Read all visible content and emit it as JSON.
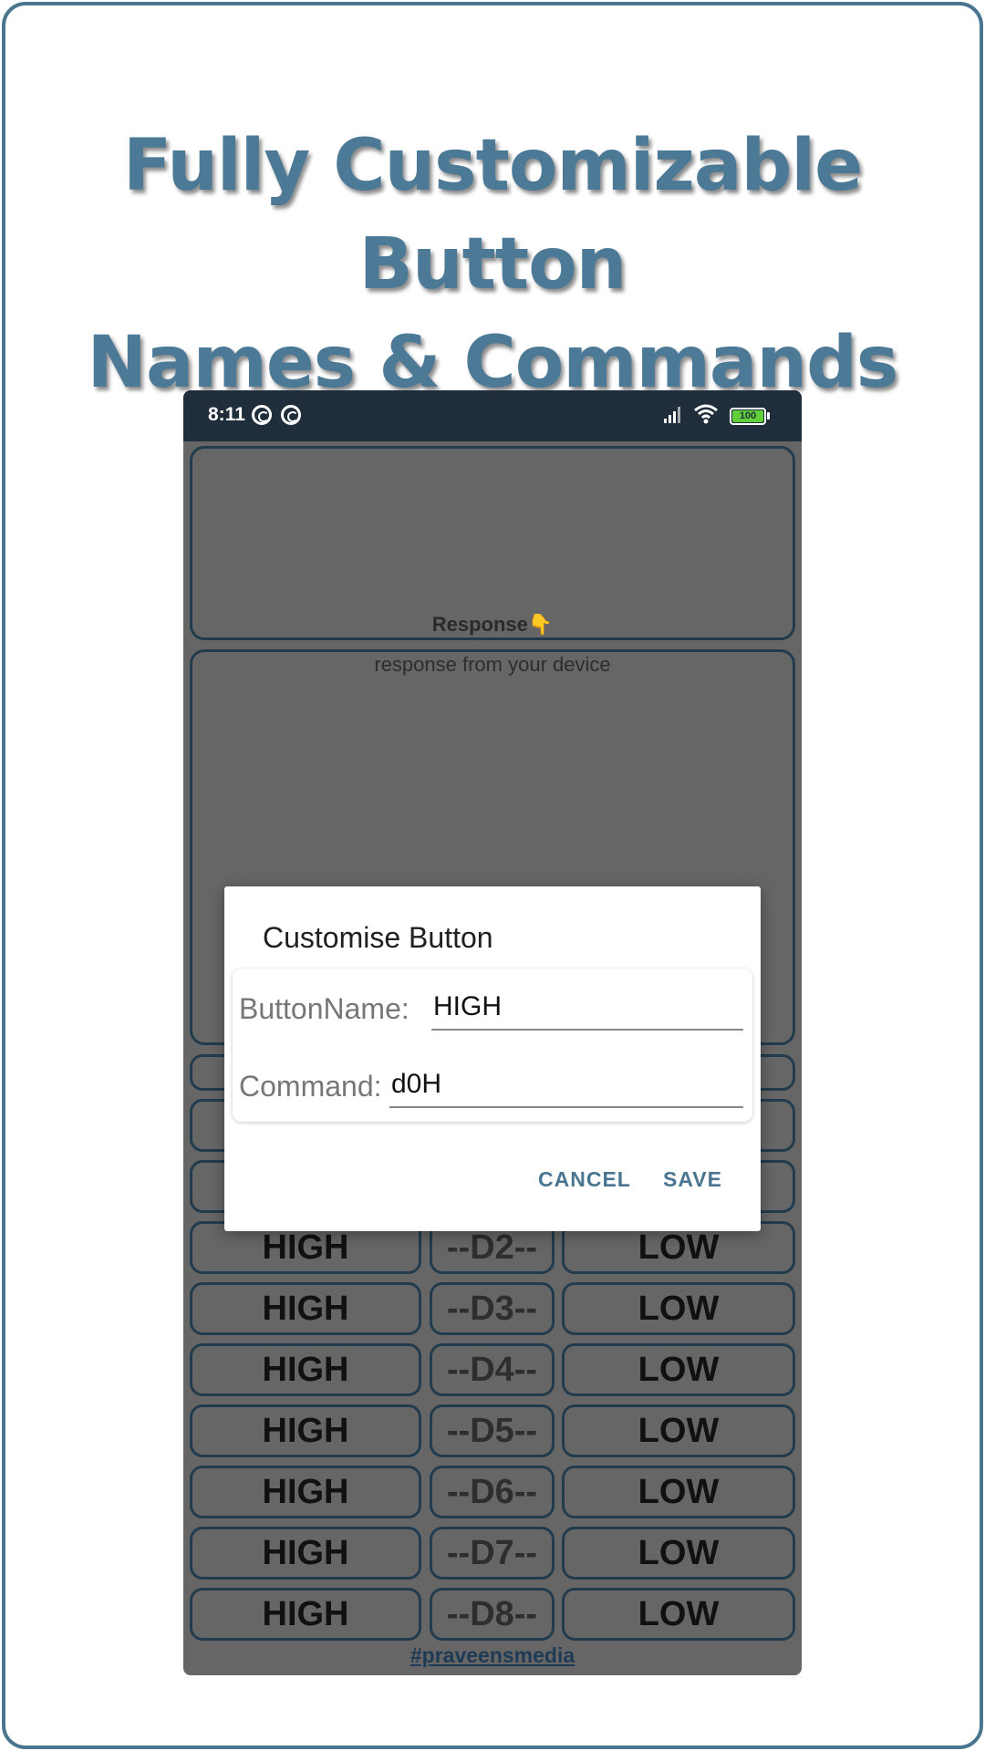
{
  "headline": {
    "line1": "Fully Customizable Button",
    "line2": "Names & Commands"
  },
  "status_bar": {
    "time": "8:11",
    "battery": "100",
    "icons": [
      "app-notification-icon",
      "app-notification-icon",
      "signal-icon",
      "wifi-icon",
      "battery-icon"
    ]
  },
  "response": {
    "label": "Response",
    "label_emoji": "👇",
    "placeholder": "response from your device"
  },
  "rows": [
    {
      "high": "HIGH",
      "pin": "--D2--",
      "low": "LOW"
    },
    {
      "high": "HIGH",
      "pin": "--D3--",
      "low": "LOW"
    },
    {
      "high": "HIGH",
      "pin": "--D4--",
      "low": "LOW"
    },
    {
      "high": "HIGH",
      "pin": "--D5--",
      "low": "LOW"
    },
    {
      "high": "HIGH",
      "pin": "--D6--",
      "low": "LOW"
    },
    {
      "high": "HIGH",
      "pin": "--D7--",
      "low": "LOW"
    },
    {
      "high": "HIGH",
      "pin": "--D8--",
      "low": "LOW"
    }
  ],
  "footer": {
    "link": "#praveensmedia"
  },
  "dialog": {
    "title": "Customise Button",
    "button_name_label": "ButtonName:",
    "button_name_value": "HIGH",
    "command_label": "Command:",
    "command_value": "d0H",
    "cancel": "CANCEL",
    "save": "SAVE"
  },
  "colors": {
    "accent": "#4a7591",
    "statusbar": "#1f2e3a",
    "screen_dim": "#666666",
    "outline": "#223b4d"
  }
}
